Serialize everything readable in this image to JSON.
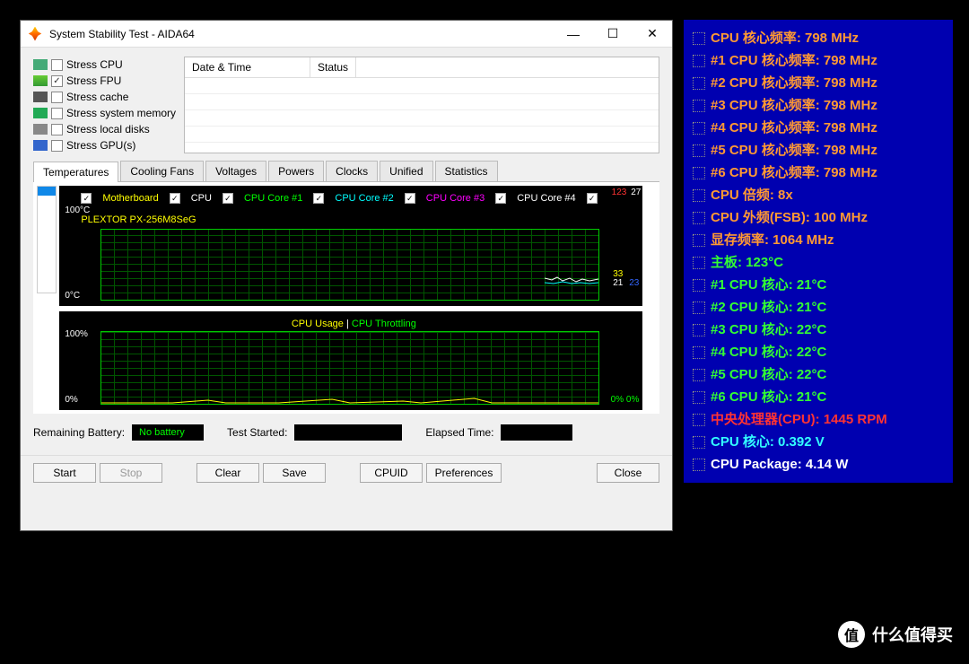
{
  "window": {
    "title": "System Stability Test - AIDA64",
    "minimize": "—",
    "maximize": "☐",
    "close": "✕"
  },
  "stress": [
    {
      "label": "Stress CPU",
      "checked": false
    },
    {
      "label": "Stress FPU",
      "checked": true
    },
    {
      "label": "Stress cache",
      "checked": false
    },
    {
      "label": "Stress system memory",
      "checked": false
    },
    {
      "label": "Stress local disks",
      "checked": false
    },
    {
      "label": "Stress GPU(s)",
      "checked": false
    }
  ],
  "log": {
    "col1": "Date & Time",
    "col2": "Status"
  },
  "tabs": [
    "Temperatures",
    "Cooling Fans",
    "Voltages",
    "Powers",
    "Clocks",
    "Unified",
    "Statistics"
  ],
  "activeTab": 0,
  "tempGraph": {
    "yMaxLabel": "100°C",
    "yMinLabel": "0°C",
    "topRight1": "123",
    "topRight2": "27",
    "rightLabel1": "33",
    "rightLabel2": "21",
    "rightLabel3": "23",
    "legend": [
      {
        "label": "Motherboard",
        "cls": "yellow"
      },
      {
        "label": "CPU",
        "cls": "white"
      },
      {
        "label": "CPU Core #1",
        "cls": "green"
      },
      {
        "label": "CPU Core #2",
        "cls": "cyan"
      },
      {
        "label": "CPU Core #3",
        "cls": "magenta"
      },
      {
        "label": "CPU Core #4",
        "cls": "white"
      },
      {
        "label": "PLEXTOR PX-256M8SeG",
        "cls": "yellow"
      }
    ]
  },
  "usageGraph": {
    "title1": "CPU Usage",
    "sep": "  |  ",
    "title2": "CPU Throttling",
    "yMax": "100%",
    "yMin": "0%",
    "rightLabel": "0% 0%"
  },
  "status": {
    "batteryLabel": "Remaining Battery:",
    "batteryValue": "No battery",
    "startedLabel": "Test Started:",
    "elapsedLabel": "Elapsed Time:"
  },
  "buttons": {
    "start": "Start",
    "stop": "Stop",
    "clear": "Clear",
    "save": "Save",
    "cpuid": "CPUID",
    "prefs": "Preferences",
    "close": "Close"
  },
  "side": [
    {
      "text": "CPU 核心频率: 798 MHz",
      "cls": "sp-orange"
    },
    {
      "text": "#1 CPU 核心频率: 798 MHz",
      "cls": "sp-orange"
    },
    {
      "text": "#2 CPU 核心频率: 798 MHz",
      "cls": "sp-orange"
    },
    {
      "text": "#3 CPU 核心频率: 798 MHz",
      "cls": "sp-orange"
    },
    {
      "text": "#4 CPU 核心频率: 798 MHz",
      "cls": "sp-orange"
    },
    {
      "text": "#5 CPU 核心频率: 798 MHz",
      "cls": "sp-orange"
    },
    {
      "text": "#6 CPU 核心频率: 798 MHz",
      "cls": "sp-orange"
    },
    {
      "text": "CPU 倍频: 8x",
      "cls": "sp-orange"
    },
    {
      "text": "CPU 外频(FSB): 100 MHz",
      "cls": "sp-orange"
    },
    {
      "text": "显存频率: 1064 MHz",
      "cls": "sp-orange"
    },
    {
      "text": "主板: 123°C",
      "cls": "sp-green"
    },
    {
      "text": " #1 CPU 核心: 21°C",
      "cls": "sp-green"
    },
    {
      "text": " #2 CPU 核心: 21°C",
      "cls": "sp-green"
    },
    {
      "text": " #3 CPU 核心: 22°C",
      "cls": "sp-green"
    },
    {
      "text": " #4 CPU 核心: 22°C",
      "cls": "sp-green"
    },
    {
      "text": " #5 CPU 核心: 22°C",
      "cls": "sp-green"
    },
    {
      "text": " #6 CPU 核心: 21°C",
      "cls": "sp-green"
    },
    {
      "text": "中央处理器(CPU): 1445 RPM",
      "cls": "sp-red"
    },
    {
      "text": "CPU 核心: 0.392 V",
      "cls": "sp-cyan"
    },
    {
      "text": "CPU Package: 4.14 W",
      "cls": "sp-white"
    }
  ],
  "watermark": {
    "symbol": "值",
    "text": "什么值得买"
  },
  "chart_data": [
    {
      "type": "line",
      "title": "Temperatures",
      "ylabel": "°C",
      "ylim": [
        0,
        100
      ],
      "series": [
        {
          "name": "Motherboard",
          "current": 123
        },
        {
          "name": "CPU",
          "current": 27
        },
        {
          "name": "CPU Core #1",
          "current": 21
        },
        {
          "name": "CPU Core #2",
          "current": 21
        },
        {
          "name": "CPU Core #3",
          "current": 22
        },
        {
          "name": "CPU Core #4",
          "current": 22
        },
        {
          "name": "PLEXTOR PX-256M8SeG",
          "current": 33
        }
      ]
    },
    {
      "type": "line",
      "title": "CPU Usage | CPU Throttling",
      "ylabel": "%",
      "ylim": [
        0,
        100
      ],
      "series": [
        {
          "name": "CPU Usage",
          "current": 0
        },
        {
          "name": "CPU Throttling",
          "current": 0
        }
      ]
    }
  ]
}
